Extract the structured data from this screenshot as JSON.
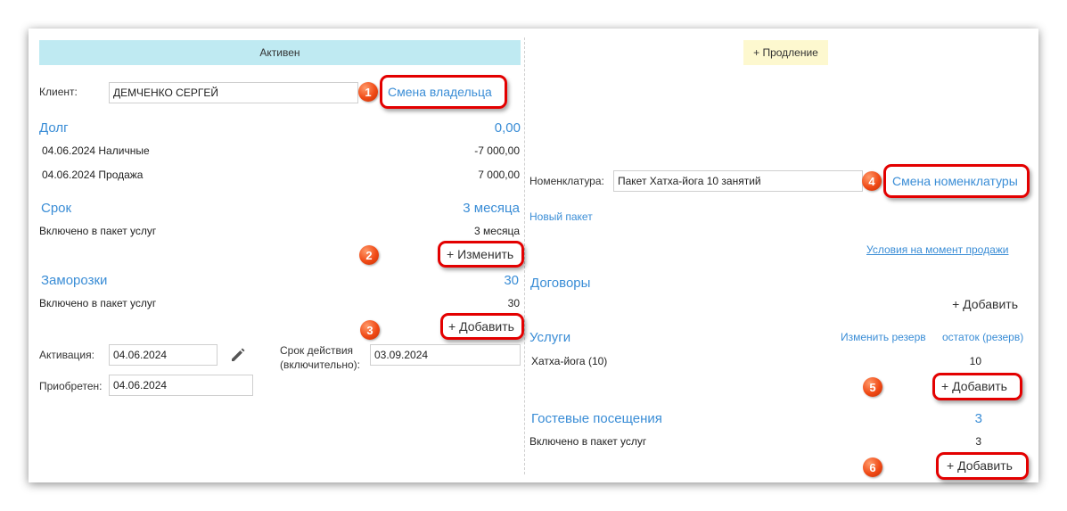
{
  "left": {
    "status": "Активен",
    "client": {
      "label": "Клиент:",
      "value": "ДЕМЧЕНКО СЕРГЕЙ",
      "change_owner": "Смена владельца"
    },
    "debt": {
      "title": "Долг",
      "total": "0,00",
      "rows": [
        {
          "label": "04.06.2024 Наличные",
          "amount": "-7 000,00"
        },
        {
          "label": "04.06.2024 Продажа",
          "amount": "7 000,00"
        }
      ]
    },
    "term": {
      "title": "Срок",
      "value": "3 месяца",
      "included_label": "Включено в пакет услуг",
      "included_value": "3 месяца",
      "change_button": "+ Изменить"
    },
    "freezes": {
      "title": "Заморозки",
      "value": "30",
      "included_label": "Включено в пакет услуг",
      "included_value": "30",
      "add_button": "+ Добавить"
    },
    "activation": {
      "label": "Активация:",
      "value": "04.06.2024"
    },
    "validity": {
      "label_line1": "Срок действия",
      "label_line2": "(включительно):",
      "value": "03.09.2024"
    },
    "acquired": {
      "label": "Приобретен:",
      "value": "04.06.2024"
    }
  },
  "right": {
    "renewal_button": "+ Продление",
    "nomenclature": {
      "label": "Номенклатура:",
      "value": "Пакет Хатха-йога 10 занятий",
      "change": "Смена номенклатуры"
    },
    "new_package": "Новый пакет",
    "sale_conditions": "Условия на момент продажи",
    "contracts": {
      "title": "Договоры",
      "add_button": "+ Добавить"
    },
    "services": {
      "title": "Услуги",
      "change_reserve": "Изменить резерв",
      "remainder": "остаток (резерв)",
      "rows": [
        {
          "name": "Хатха-йога (10)",
          "value": "10"
        }
      ],
      "add_button": "+ Добавить"
    },
    "guest_visits": {
      "title": "Гостевые посещения",
      "value": "3",
      "included_label": "Включено в пакет услуг",
      "included_value": "3",
      "add_button": "+ Добавить"
    }
  },
  "badges": [
    "1",
    "2",
    "3",
    "4",
    "5",
    "6"
  ],
  "colors": {
    "accent": "#3a8dd6",
    "status_bg": "#bfeaf2",
    "renewal_bg": "#fdf8cf",
    "highlight": "#e30000",
    "badge": "#f04a16"
  }
}
